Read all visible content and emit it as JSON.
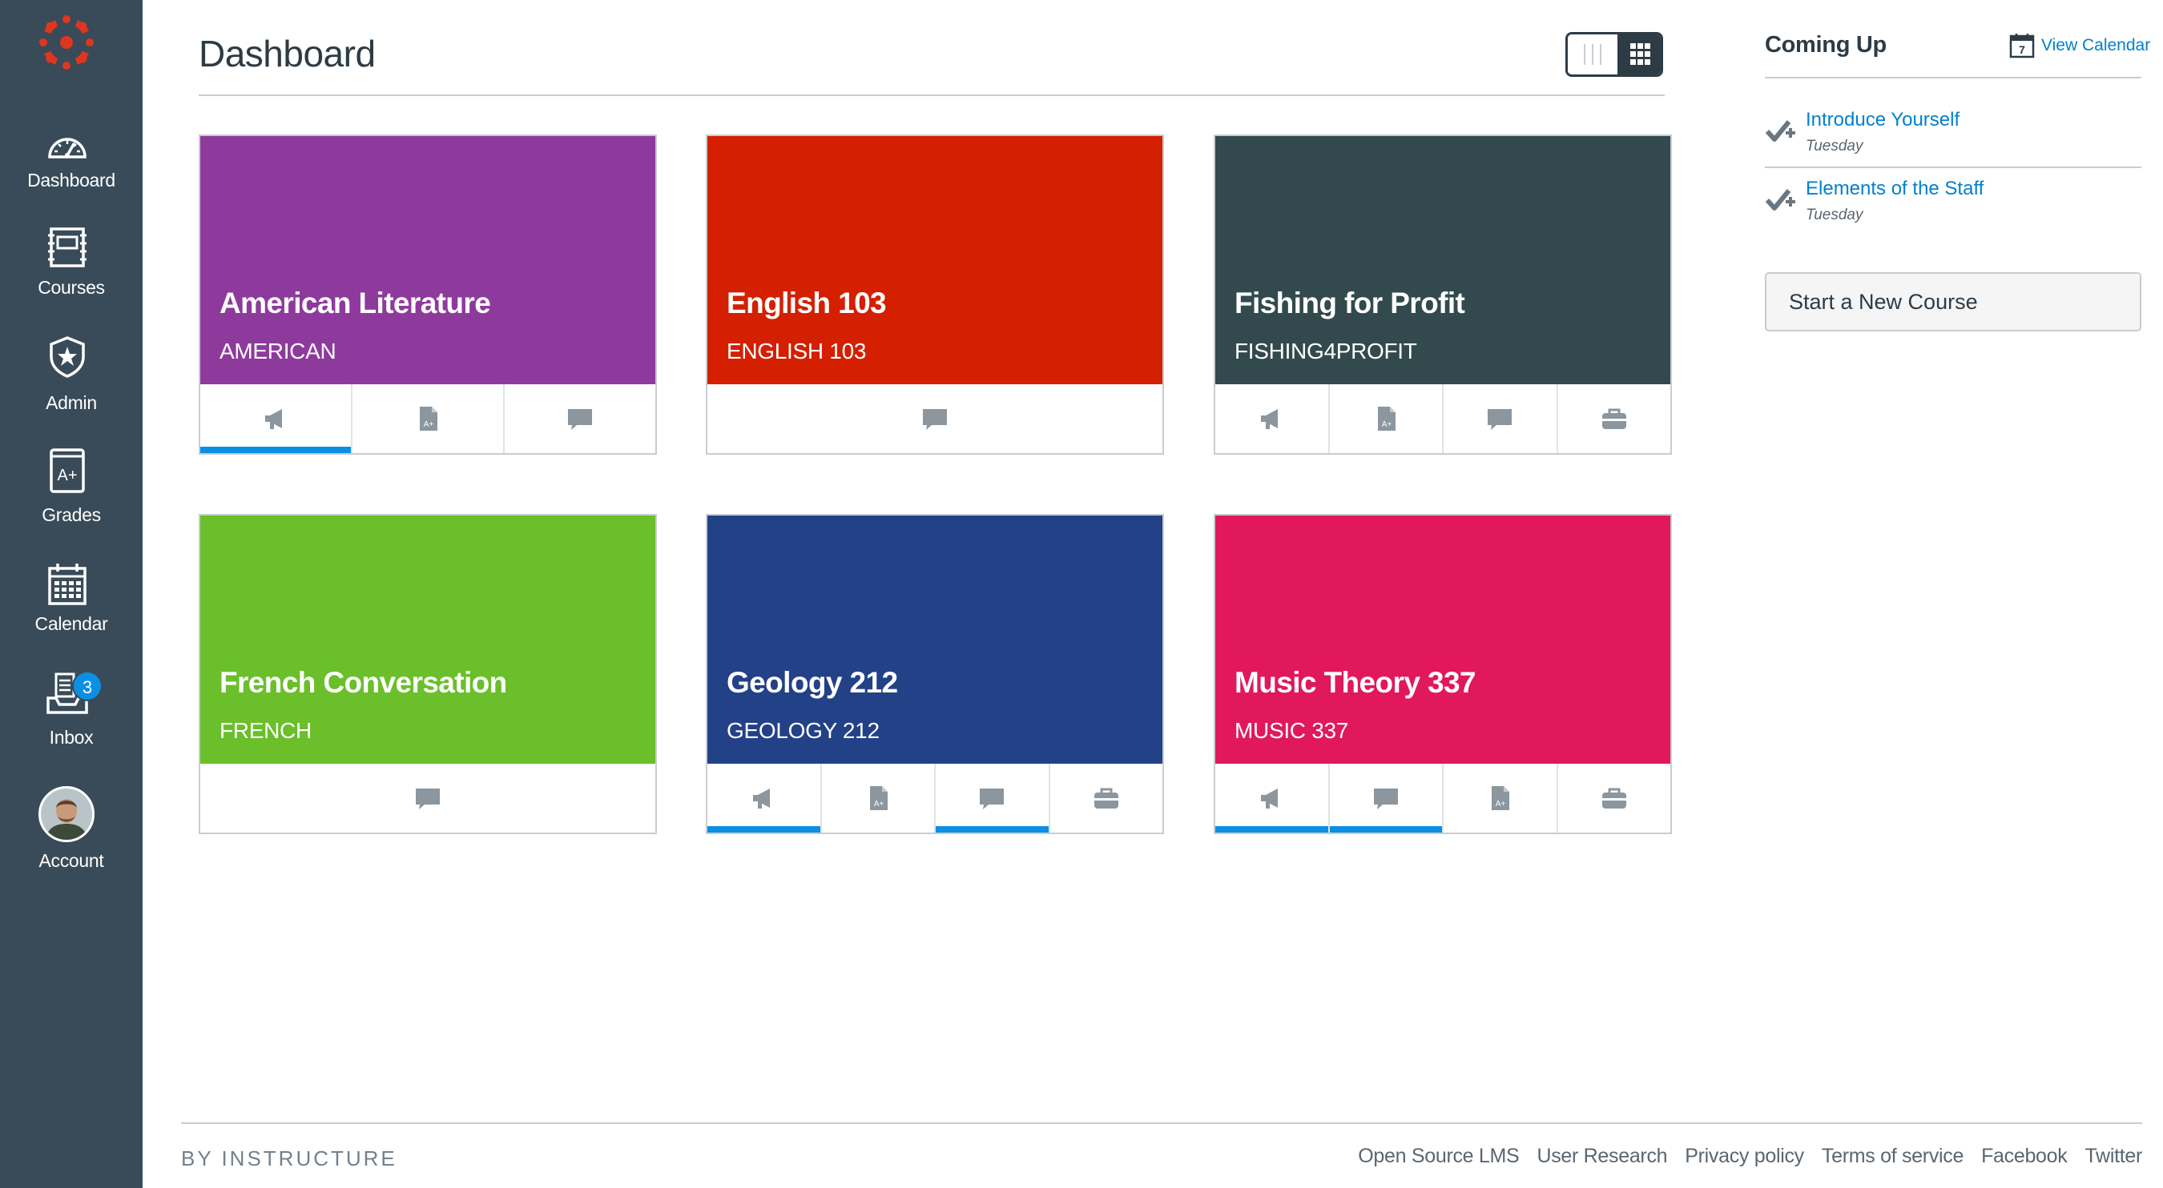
{
  "nav": {
    "items": [
      {
        "label": "Dashboard",
        "icon": "dashboard-icon"
      },
      {
        "label": "Courses",
        "icon": "courses-icon"
      },
      {
        "label": "Admin",
        "icon": "admin-shield-icon"
      },
      {
        "label": "Grades",
        "icon": "grades-icon"
      },
      {
        "label": "Calendar",
        "icon": "calendar-icon"
      },
      {
        "label": "Inbox",
        "icon": "inbox-icon",
        "badge": "3"
      },
      {
        "label": "Account",
        "icon": "avatar"
      }
    ],
    "color": "#394b58",
    "logo_color": "#e0361f"
  },
  "header": {
    "title": "Dashboard"
  },
  "courses": [
    {
      "name": "American Literature",
      "code": "AMERICAN",
      "color": "#8e3a9d",
      "actions": [
        {
          "icon": "announcement-icon",
          "unread": true
        },
        {
          "icon": "assignments-icon",
          "unread": false
        },
        {
          "icon": "discussions-icon",
          "unread": false
        }
      ]
    },
    {
      "name": "English 103",
      "code": "ENGLISH 103",
      "color": "#d41f00",
      "actions": [
        {
          "icon": "discussions-icon",
          "unread": false
        }
      ]
    },
    {
      "name": "Fishing for Profit",
      "code": "FISHING4PROFIT",
      "color": "#324a4d",
      "actions": [
        {
          "icon": "announcement-icon",
          "unread": false
        },
        {
          "icon": "assignments-icon",
          "unread": false
        },
        {
          "icon": "discussions-icon",
          "unread": false
        },
        {
          "icon": "files-icon",
          "unread": false
        }
      ]
    },
    {
      "name": "French Conversation",
      "code": "FRENCH",
      "color": "#6abf2a",
      "actions": [
        {
          "icon": "discussions-icon",
          "unread": false
        }
      ]
    },
    {
      "name": "Geology 212",
      "code": "GEOLOGY 212",
      "color": "#234187",
      "actions": [
        {
          "icon": "announcement-icon",
          "unread": true
        },
        {
          "icon": "assignments-icon",
          "unread": false
        },
        {
          "icon": "discussions-icon",
          "unread": true
        },
        {
          "icon": "files-icon",
          "unread": false
        }
      ]
    },
    {
      "name": "Music Theory 337",
      "code": "MUSIC 337",
      "color": "#e1185c",
      "actions": [
        {
          "icon": "announcement-icon",
          "unread": true
        },
        {
          "icon": "discussions-icon",
          "unread": true
        },
        {
          "icon": "assignments-icon",
          "unread": false
        },
        {
          "icon": "files-icon",
          "unread": false
        }
      ]
    }
  ],
  "coming_up": {
    "title": "Coming Up",
    "calendar_link": "View Calendar",
    "calendar_day": "7",
    "items": [
      {
        "title": "Introduce Yourself",
        "date": "Tuesday"
      },
      {
        "title": "Elements of the Staff",
        "date": "Tuesday"
      }
    ],
    "start_button": "Start a New Course"
  },
  "footer": {
    "brand": "BY INSTRUCTURE",
    "links": [
      "Open Source LMS",
      "User Research",
      "Privacy policy",
      "Terms of service",
      "Facebook",
      "Twitter"
    ]
  },
  "colors": {
    "accent": "#0b8fe4",
    "link": "#0081cc"
  }
}
